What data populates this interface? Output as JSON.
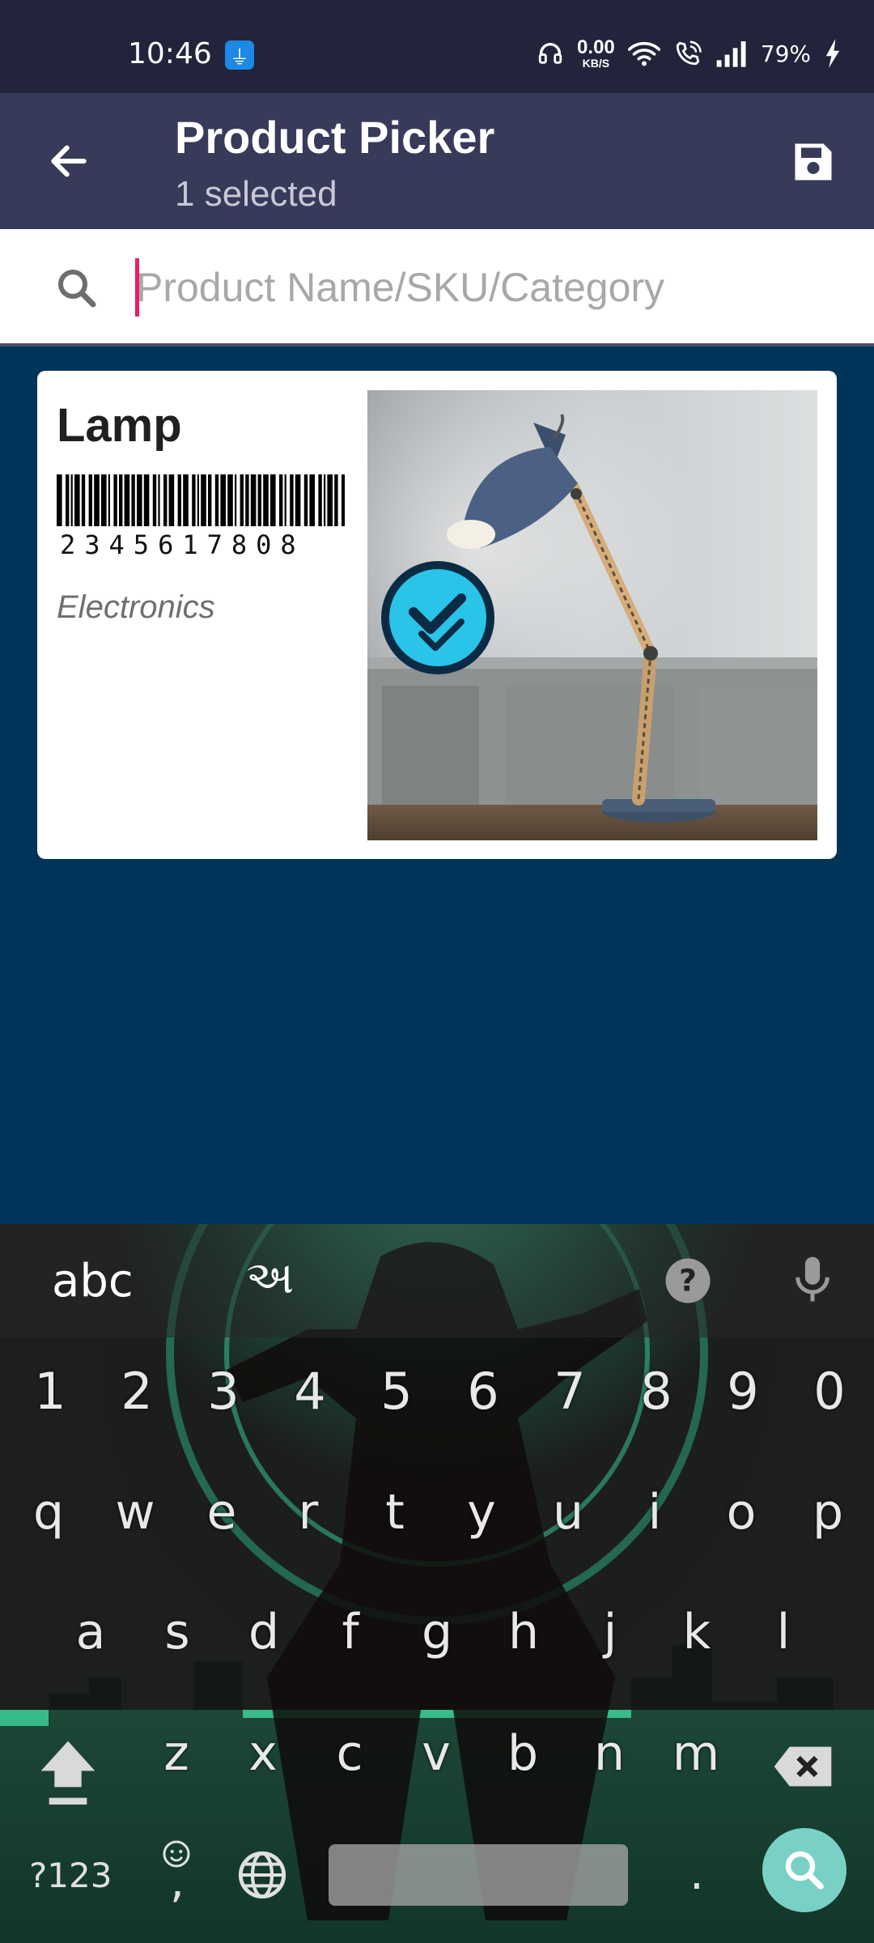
{
  "status_bar": {
    "time": "10:46",
    "net_speed_value": "0.00",
    "net_speed_unit": "KB/S",
    "battery": "79%",
    "icons": [
      "usb-icon",
      "headphones-icon",
      "wifi-icon",
      "wifi-calling-icon",
      "signal-icon",
      "charging-icon"
    ]
  },
  "app_bar": {
    "title": "Product Picker",
    "subtitle": "1 selected",
    "icons": [
      "back-arrow-icon",
      "save-icon"
    ]
  },
  "search": {
    "value": "",
    "placeholder": "Product Name/SKU/Category"
  },
  "products": [
    {
      "name": "Lamp",
      "sku": "2345617808",
      "category": "Electronics",
      "selected": true,
      "image": "desk-lamp-photo"
    }
  ],
  "keyboard": {
    "mode_label": "abc",
    "lang_label": "અ",
    "number_row": [
      "1",
      "2",
      "3",
      "4",
      "5",
      "6",
      "7",
      "8",
      "9",
      "0"
    ],
    "row1": [
      "q",
      "w",
      "e",
      "r",
      "t",
      "y",
      "u",
      "i",
      "o",
      "p"
    ],
    "row2": [
      "a",
      "s",
      "d",
      "f",
      "g",
      "h",
      "j",
      "k",
      "l"
    ],
    "row3": [
      "z",
      "x",
      "c",
      "v",
      "b",
      "n",
      "m"
    ],
    "symbols_label": "?123",
    "comma": ",",
    "period": ".",
    "icons": [
      "help-icon",
      "mic-icon",
      "shift-icon",
      "backspace-icon",
      "emoji-icon",
      "globe-icon",
      "search-icon"
    ]
  },
  "colors": {
    "status_bar": "#21243a",
    "app_bar": "#383a59",
    "background": "#003459",
    "accent_cursor": "#e91e63",
    "check_badge": "#29c4e8",
    "keyboard_accent": "#79d1c6"
  }
}
